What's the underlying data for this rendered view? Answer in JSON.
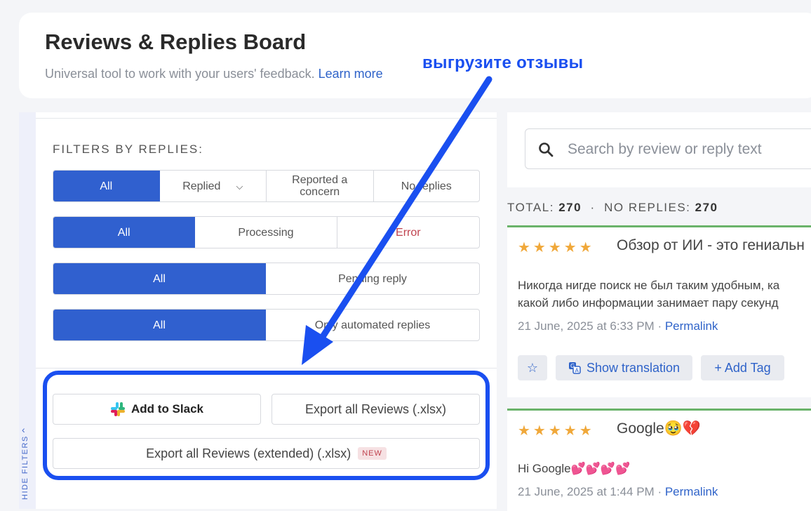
{
  "header": {
    "title": "Reviews & Replies Board",
    "subtitle": "Universal tool to work with your users' feedback.",
    "learn_more": "Learn more"
  },
  "annotation": {
    "text": "выгрузите отзывы",
    "color": "#1a4ff0"
  },
  "sidebar": {
    "hide_filters": "HIDE FILTERS"
  },
  "filters": {
    "heading": "FILTERS BY REPLIES:",
    "row1": [
      "All",
      "Replied",
      "Reported a concern",
      "No replies"
    ],
    "row2": [
      "All",
      "Processing",
      "Error"
    ],
    "row3": [
      "All",
      "Pending reply"
    ],
    "row4": [
      "All",
      "Only automated replies"
    ],
    "active_color": "#3060cf"
  },
  "actions": {
    "slack": "Add to Slack",
    "export": "Export all Reviews (.xlsx)",
    "export_extended": "Export all Reviews (extended) (.xlsx)",
    "new_badge": "NEW"
  },
  "search": {
    "placeholder": "Search by review or reply text"
  },
  "totals": {
    "total_label": "TOTAL:",
    "total": "270",
    "sep": "·",
    "no_replies_label": "NO REPLIES:",
    "no_replies": "270"
  },
  "reviews": [
    {
      "stars": "★★★★★",
      "title": "Обзор от ИИ - это гениальн",
      "body_line1": "Никогда нигде поиск не был таким удобным, ка",
      "body_line2": "какой либо информации занимает пару секунд",
      "date": "21 June, 2025 at 6:33 PM",
      "dot": "·",
      "permalink": "Permalink",
      "actions": {
        "star": "☆",
        "show_translation": "Show translation",
        "add_tag": "+ Add Tag"
      }
    },
    {
      "stars": "★★★★★",
      "title": "Google🥹💔",
      "body_line1": "Hi Google💕💕💕💕",
      "date": "21 June, 2025 at 1:44 PM",
      "dot": "·",
      "permalink": "Permalink"
    }
  ]
}
